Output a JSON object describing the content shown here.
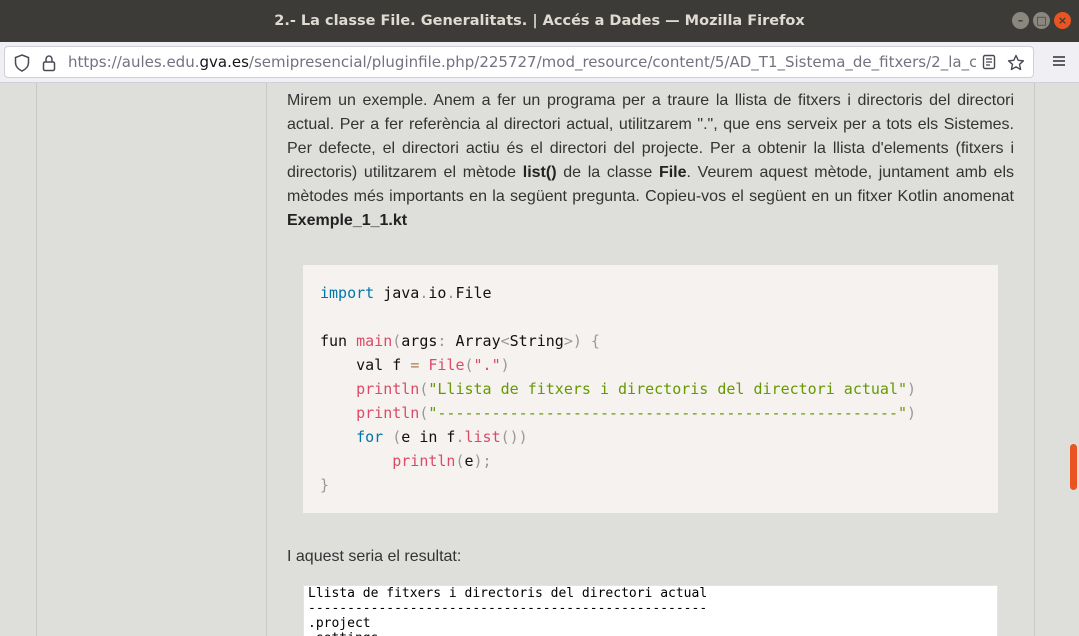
{
  "window": {
    "title": "2.- La classe File. Generalitats. | Accés a Dades — Mozilla Firefox"
  },
  "navbar": {
    "url_prefix": "https://aules.edu.",
    "url_domain": "gva.es",
    "url_rest": "/semipresencial/pluginfile.php/225727/mod_resource/content/5/AD_T1_Sistema_de_fitxers/2_la_classe_f"
  },
  "content": {
    "para1_a": "Mirem un exemple. Anem a fer un programa per a traure la llista de fitxers i directoris del directori actual. Per a fer referència al directori actual, utilitzarem \".\", que ens serveix per a tots els Sistemes. Per defecte, el directori actiu és el directori del projecte. Per a obtenir la llista d'elements (fitxers i directoris) utilitzarem el mètode ",
    "para1_b1": "list()",
    "para1_c": " de la classe ",
    "para1_b2": "File",
    "para1_d": ". Veurem aquest mètode, juntament amb els mètodes més importants en la següent pregunta. Copieu-vos el següent en un fitxer Kotlin anomenat ",
    "para1_b3": "Exemple_1_1.kt",
    "para2": "I aquest seria el resultat:",
    "code": {
      "l1_kw": "import",
      "l1_rest": " java",
      "l1_dot1": ".",
      "l1_io": "io",
      "l1_dot2": ".",
      "l1_file": "File",
      "l3_fun": "fun ",
      "l3_main": "main",
      "l3_p1": "(",
      "l3_args": "args",
      "l3_colon": ":",
      "l3_array": " Array",
      "l3_lt": "<",
      "l3_string": "String",
      "l3_gt": ">",
      "l3_p2": ")",
      "l3_brace": " {",
      "l4_val": "    val f ",
      "l4_eq": "=",
      "l4_file": " File",
      "l4_p1": "(",
      "l4_str": "\".\"",
      "l4_p2": ")",
      "l5_fn": "    println",
      "l5_p1": "(",
      "l5_str": "\"Llista de fitxers i directoris del directori actual\"",
      "l5_p2": ")",
      "l6_fn": "    println",
      "l6_p1": "(",
      "l6_str": "\"---------------------------------------------------\"",
      "l6_p2": ")",
      "l7_for": "    for",
      "l7_p1": " (",
      "l7_e": "e ",
      "l7_in": "in",
      "l7_f": " f",
      "l7_dot": ".",
      "l7_list": "list",
      "l7_p2": "())",
      "l8_fn": "        println",
      "l8_p1": "(",
      "l8_e": "e",
      "l8_p2": ");",
      "l9": "}"
    },
    "output_lines": "Llista de fitxers i directoris del directori actual\n---------------------------------------------------\n.project\n.settings"
  },
  "icons": [
    "shield-icon",
    "lock-icon",
    "reader-view-icon",
    "bookmark-star-icon",
    "hamburger-menu-icon",
    "minimize-icon",
    "maximize-icon",
    "close-icon"
  ]
}
